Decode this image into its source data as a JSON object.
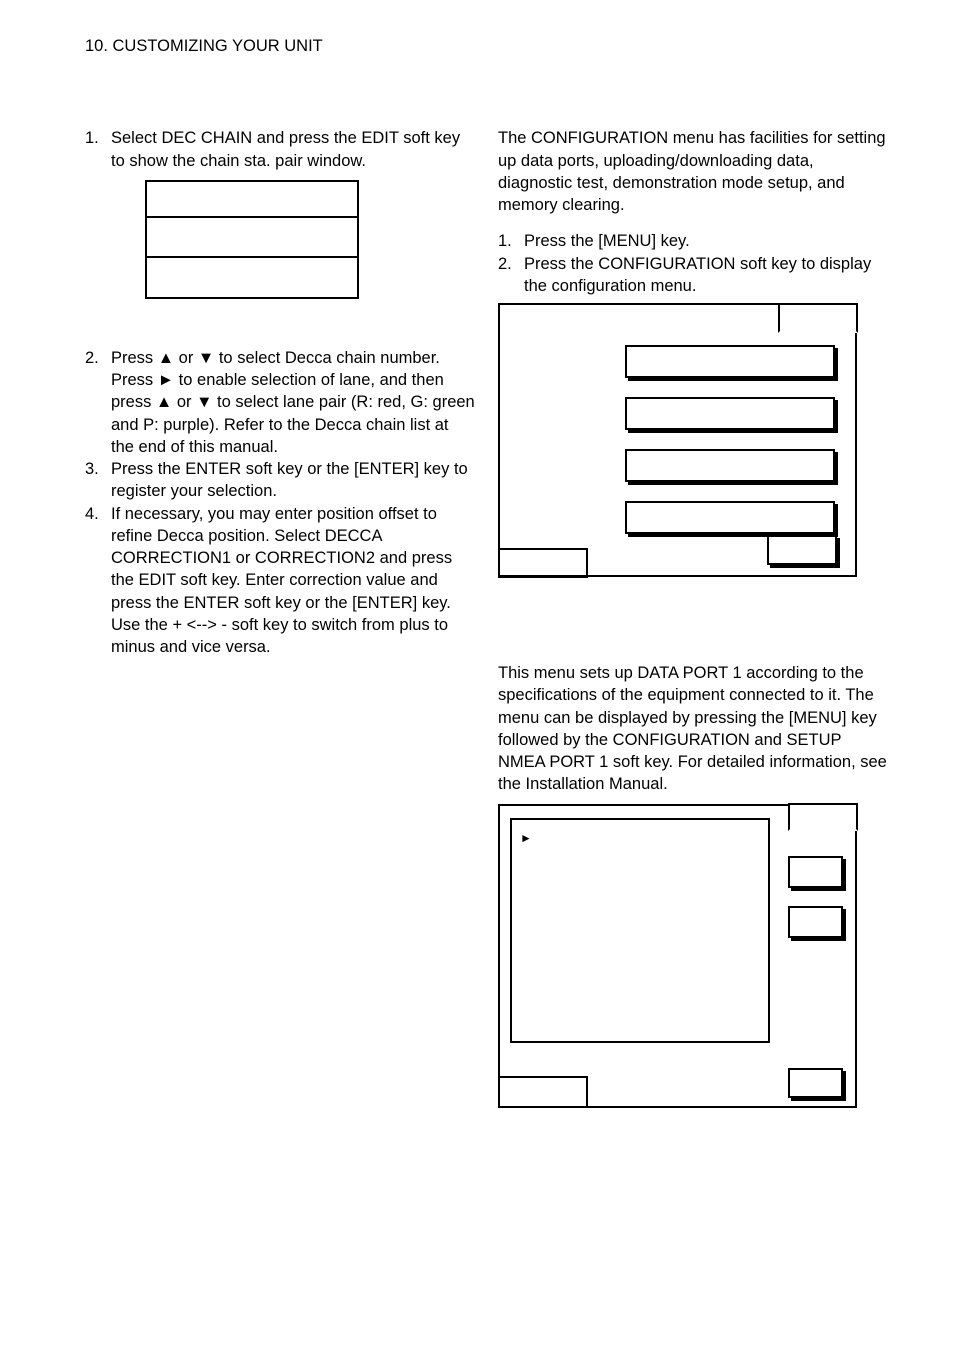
{
  "chapter": "10. CUSTOMIZING YOUR UNIT",
  "left": {
    "step1_num": "1.",
    "step1_txt": "Select DEC CHAIN and press the EDIT soft key to show the chain sta. pair window.",
    "step2_num": "2.",
    "step2_txt": "Press ▲ or ▼ to select Decca chain number. Press ► to enable selection of lane, and then press ▲ or ▼ to select lane pair (R: red, G: green and P: purple). Refer to the Decca chain list at the end of this manual.",
    "step3_num": "3.",
    "step3_txt": "Press the ENTER soft key or the [ENTER] key to register your selection.",
    "step4_num": "4.",
    "step4_txt": "If necessary, you may enter position offset to refine Decca position. Select DECCA CORRECTION1 or CORRECTION2 and press the EDIT soft key. Enter correction value and press the ENTER soft key or the [ENTER] key. Use the + <--> - soft key to switch from plus to minus and vice versa."
  },
  "right": {
    "intro": "The CONFIGURATION menu has facilities for setting up data ports, uploading/downloading data, diagnostic test, demonstration mode setup, and memory clearing.",
    "r1_num": "1.",
    "r1_txt": "Press the [MENU] key.",
    "r2_num": "2.",
    "r2_txt": "Press the CONFIGURATION soft key to display the configuration menu.",
    "setup_para": "This menu sets up DATA PORT 1 according to the specifications of the equipment connected to it. The menu can be displayed by pressing the [MENU] key followed by the CONFIGURATION and SETUP NMEA PORT 1 soft key. For detailed information, see the Installation Manual.",
    "arrow": "►"
  }
}
